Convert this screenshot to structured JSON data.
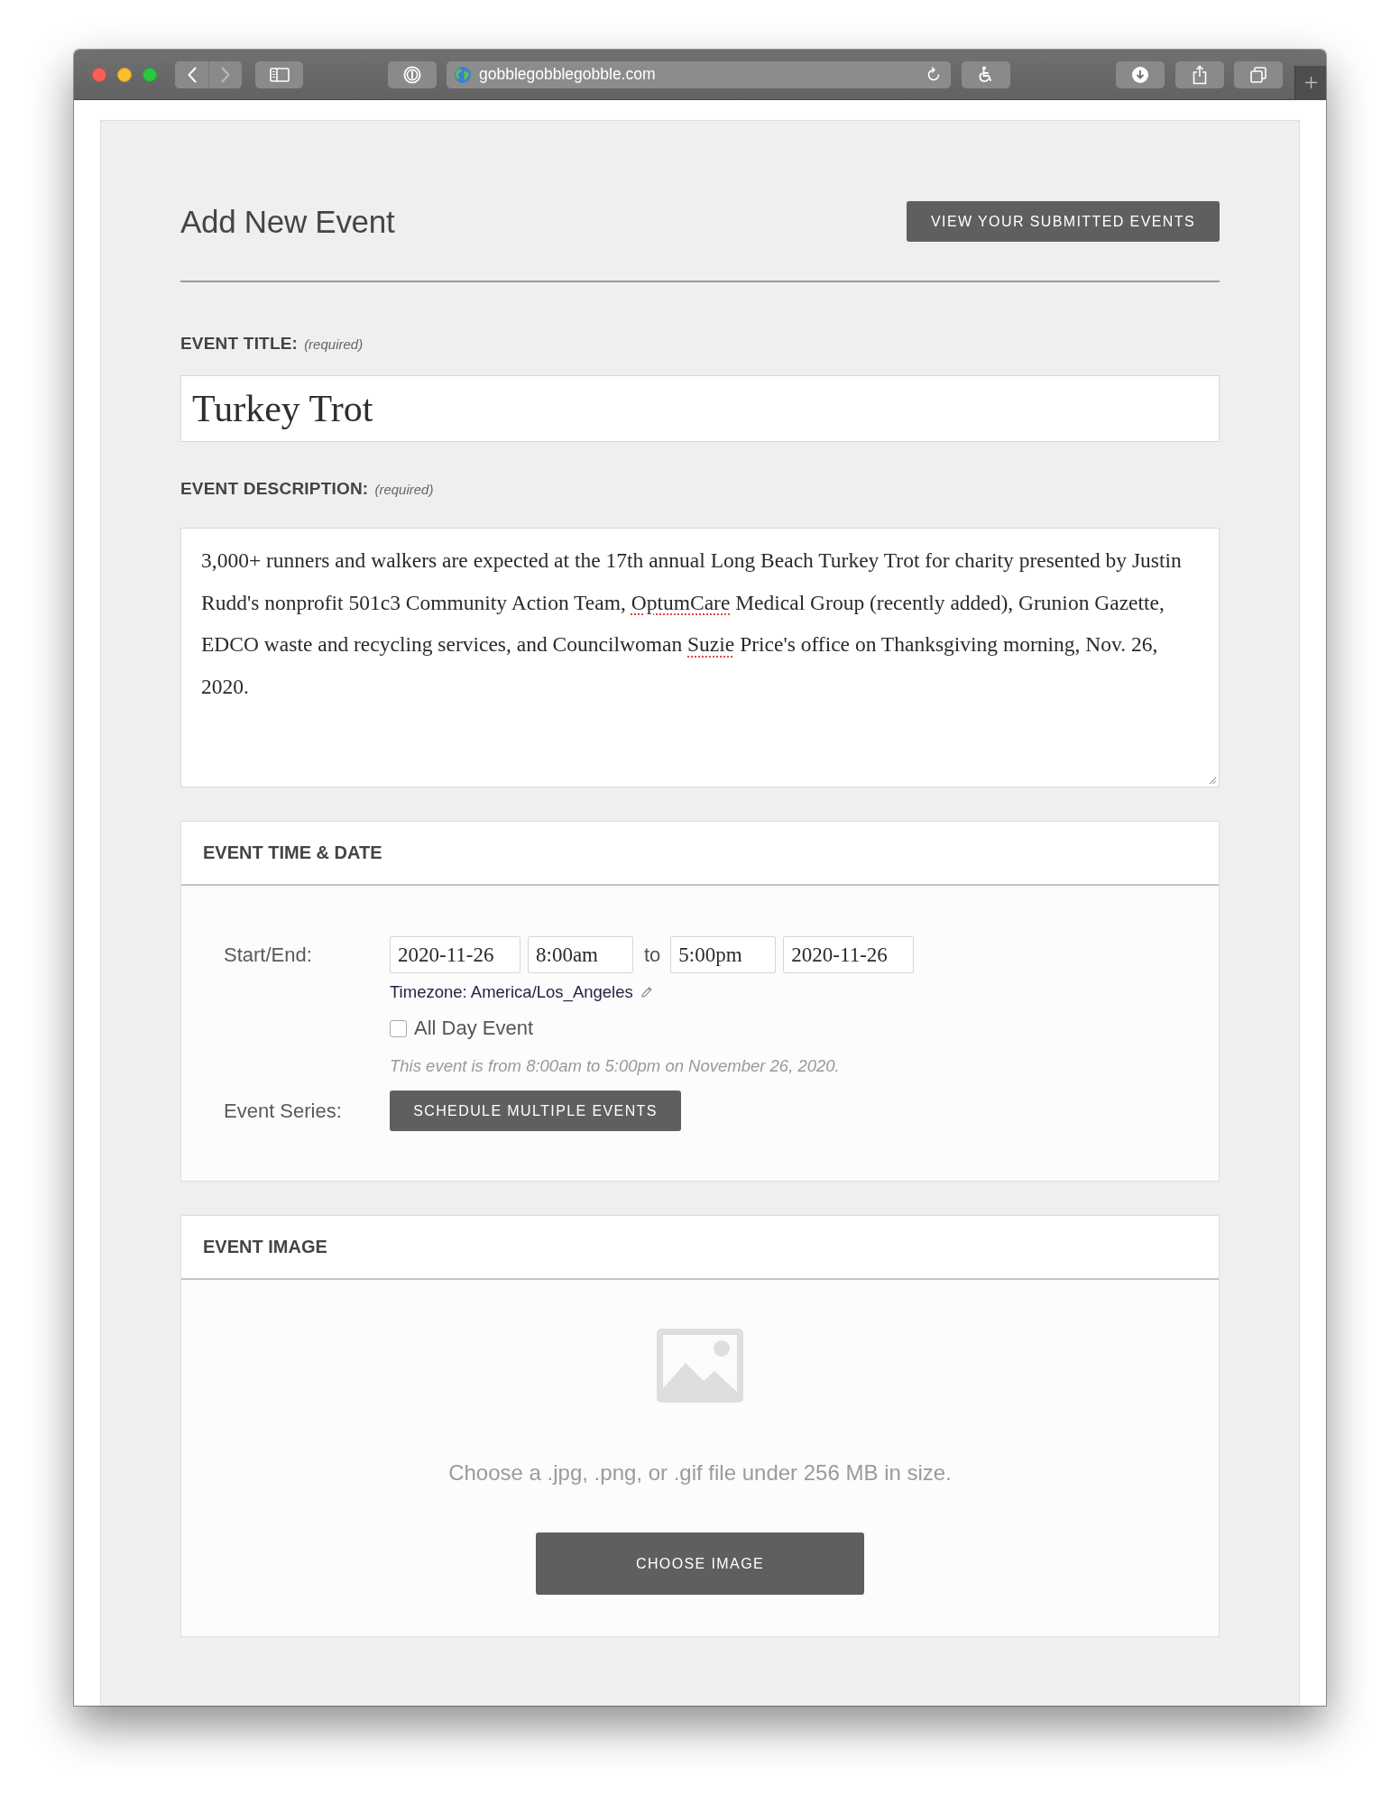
{
  "browser": {
    "nav_buttons": [
      {
        "kind": "back",
        "disabled": false
      },
      {
        "kind": "forward",
        "disabled": true
      }
    ],
    "url": "gobblegobblegobble.com"
  },
  "header": {
    "title": "Add New Event",
    "button": "VIEW YOUR SUBMITTED EVENTS"
  },
  "event_title": {
    "label": "EVENT TITLE:",
    "hint": "(required)",
    "value": "Turkey Trot"
  },
  "event_description": {
    "label": "EVENT DESCRIPTION:",
    "hint": "(required)",
    "value": [
      {
        "text": "3,000+ runners and walkers are expected at the 17th annual Long Beach Turkey Trot for charity presented by Justin Rudd's nonprofit 501c3 Community Action Team, ",
        "misspelled": false
      },
      {
        "text": "OptumCare",
        "misspelled": true
      },
      {
        "text": " Medical Group (recently added), Grunion Gazette, EDCO waste and recycling services, and Councilwoman ",
        "misspelled": false
      },
      {
        "text": "Suzie",
        "misspelled": true
      },
      {
        "text": " Price's office on Thanksgiving morning, Nov. 26, 2020.",
        "misspelled": false
      }
    ]
  },
  "time_date": {
    "heading": "EVENT TIME & DATE",
    "start_end_label": "Start/End:",
    "start_date": "2020-11-26",
    "start_time": "8:00am",
    "separator": "to",
    "end_time": "5:00pm",
    "end_date": "2020-11-26",
    "timezone": "Timezone: America/Los_Angeles",
    "all_day": {
      "label": "All Day Event",
      "checked": false
    },
    "summary": "This event is from 8:00am to 5:00pm on November 26, 2020.",
    "series_label": "Event Series:",
    "series_button": "SCHEDULE MULTIPLE EVENTS"
  },
  "event_image": {
    "heading": "EVENT IMAGE",
    "hint": "Choose a .jpg, .png, or .gif file under 256 MB in size.",
    "button": "CHOOSE IMAGE"
  }
}
